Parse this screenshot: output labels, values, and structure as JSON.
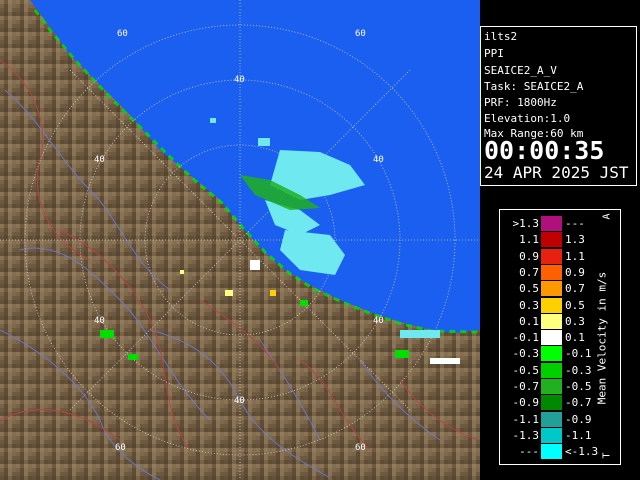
{
  "info": {
    "site": "ilts2",
    "product": "PPI",
    "scan": "SEAICE2_A_V",
    "task": "Task: SEAICE2_A",
    "prf": "PRF: 1800Hz",
    "elevation": "Elevation:1.0",
    "max_range": "Max Range:60 km",
    "time": "00:00:35",
    "date": "24 APR 2025 JST"
  },
  "map": {
    "ring_labels": [
      "60",
      "60",
      "40",
      "40",
      "40",
      "40",
      "40",
      "60",
      "60"
    ],
    "sea_color": "#1a5ff0",
    "land_color": "#7a6448"
  },
  "legend": {
    "title": "Mean Velocity in m/s",
    "corner_top": "A",
    "corner_bottom": "T",
    "rows": [
      {
        "left": ">1.3",
        "right": "---",
        "color": "#b0107c"
      },
      {
        "left": "1.1",
        "right": "1.3",
        "color": "#c00000"
      },
      {
        "left": "0.9",
        "right": "1.1",
        "color": "#e82010"
      },
      {
        "left": "0.7",
        "right": "0.9",
        "color": "#ff6000"
      },
      {
        "left": "0.5",
        "right": "0.7",
        "color": "#ff9800"
      },
      {
        "left": "0.3",
        "right": "0.5",
        "color": "#ffd000"
      },
      {
        "left": "0.1",
        "right": "0.3",
        "color": "#ffff80"
      },
      {
        "left": "-0.1",
        "right": "0.1",
        "color": "#ffffff"
      },
      {
        "left": "-0.3",
        "right": "-0.1",
        "color": "#00ff00"
      },
      {
        "left": "-0.5",
        "right": "-0.3",
        "color": "#00d000"
      },
      {
        "left": "-0.7",
        "right": "-0.5",
        "color": "#20b020"
      },
      {
        "left": "-0.9",
        "right": "-0.7",
        "color": "#008800"
      },
      {
        "left": "-1.1",
        "right": "-0.9",
        "color": "#20a098"
      },
      {
        "left": "-1.3",
        "right": "-1.1",
        "color": "#00c8c8"
      },
      {
        "left": "---",
        "right": "<-1.3",
        "color": "#00ffff"
      }
    ]
  }
}
